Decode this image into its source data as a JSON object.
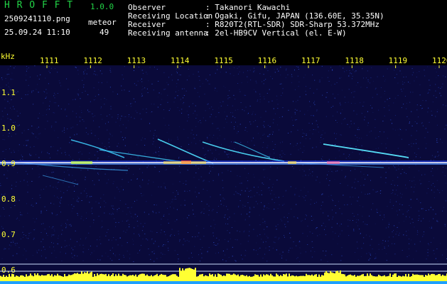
{
  "app": {
    "name": "H R O F F T",
    "version": "1.0.0",
    "filename": "2509241110.png",
    "datetime": "25.09.24 11:10",
    "mode_label": "meteor",
    "meteor_count": "49"
  },
  "info": {
    "observer_label": "Observer",
    "observer_value": ": Takanori Kawachi",
    "location_label": "Receiving Location",
    "location_value": ": Ogaki, Gifu, JAPAN (136.60E, 35.35N)",
    "receiver_label": "Receiver",
    "receiver_value": ": R820T2(RTL-SDR) SDR-Sharp 53.372MHz",
    "antenna_label": "Receiving antenna",
    "antenna_value": ": 2el-HB9CV Vertical (el. E-W)"
  },
  "spectrogram": {
    "y_unit": "kHz",
    "time_ticks": [
      "1111",
      "1112",
      "1113",
      "1114",
      "1115",
      "1116",
      "1117",
      "1118",
      "1119",
      "1120"
    ],
    "freq_ticks": [
      "1.1",
      "1.0",
      "0.9",
      "0.8",
      "0.7",
      "0.6"
    ],
    "colors": {
      "background": "#0a0a3a",
      "carrier": "#ffffff",
      "echo": "#4fe0ff",
      "axis_text": "#ffff33",
      "bar": "#ffff33",
      "bar_base": "#1ea0ff"
    }
  }
}
